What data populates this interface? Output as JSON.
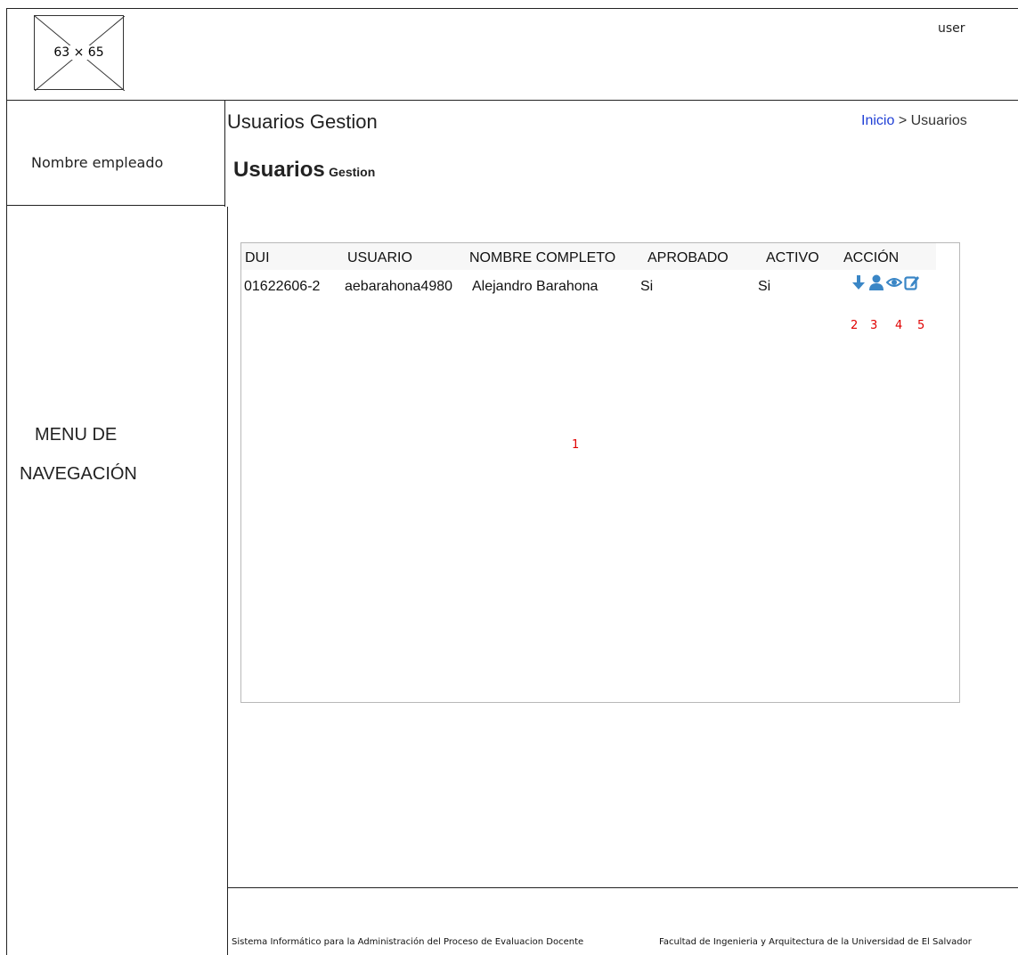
{
  "header": {
    "logo_placeholder": "63 × 65",
    "user_label": "user"
  },
  "sidebar": {
    "employee_name": "Nombre empleado",
    "menu_line1": "MENU DE",
    "menu_line2": "NAVEGACIÓN"
  },
  "main": {
    "page_title": "Usuarios Gestion",
    "breadcrumb": {
      "home": "Inicio",
      "separator": ">",
      "current": "Usuarios"
    },
    "subtitle_big": "Usuarios",
    "subtitle_small": "Gestion",
    "table": {
      "columns": [
        "DUI",
        "USUARIO",
        "NOMBRE COMPLETO",
        "APROBADO",
        "ACTIVO",
        "ACCIÓN"
      ],
      "rows": [
        {
          "dui": "01622606-2",
          "usuario": "aebarahona4980",
          "nombre": "Alejandro Barahona",
          "aprobado": "Si",
          "activo": "Si"
        }
      ],
      "action_icons": [
        "download-arrow-icon",
        "user-icon",
        "eye-icon",
        "edit-icon"
      ],
      "icon_color": "#3a86c6"
    },
    "annotations": [
      "1",
      "2",
      "3",
      "4",
      "5"
    ]
  },
  "footer": {
    "left": "Sistema Informático para la Administración del Proceso de Evaluacion Docente",
    "right": "Facultad de Ingenieria y Arquitectura de la Universidad de El Salvador"
  }
}
